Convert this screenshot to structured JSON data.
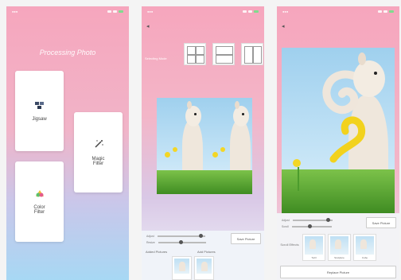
{
  "screen1": {
    "title": "Processing Photo",
    "cards": {
      "jigsaw": {
        "label": "Jigsaw",
        "icon": "jigsaw-icon"
      },
      "magic": {
        "label": "Magic Filter",
        "icon": "magic-wand-icon"
      },
      "color": {
        "label": "Color Filter",
        "icon": "color-swatch-icon"
      }
    }
  },
  "screen2": {
    "label": "Selecting Mode",
    "sliders": {
      "a": "Adjust",
      "b": "Resize"
    },
    "save_button": "Save Picture",
    "added_label": "Added Pictures",
    "add_label": "Add Pictures"
  },
  "screen3": {
    "sliders": {
      "a": "Adjust",
      "b": "Scroll"
    },
    "save_button": "Save Picture",
    "effect_label": "Scroll Effects",
    "filters": [
      "Twirl",
      "Sculpture",
      "Cube"
    ],
    "replace_button": "Replace Picture"
  }
}
